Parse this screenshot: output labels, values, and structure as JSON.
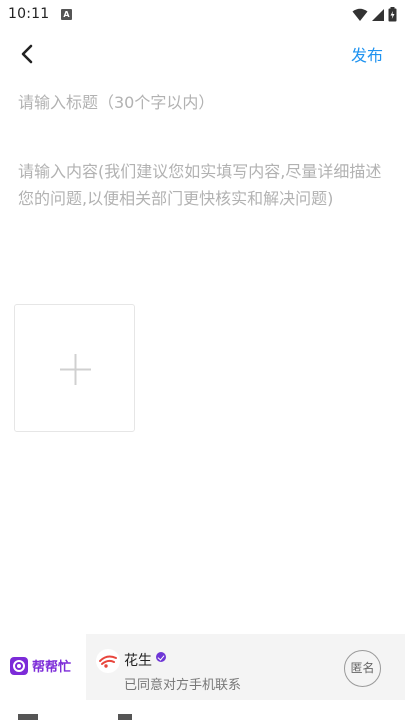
{
  "status_bar": {
    "time": "10:11",
    "app_icon": "A"
  },
  "header": {
    "back_icon": "chevron-left-icon",
    "publish_label": "发布",
    "accent_color": "#1f93f0"
  },
  "form": {
    "title_placeholder": "请输入标题（30个字以内）",
    "content_placeholder": "请输入内容(我们建议您如实填写内容,尽量详细描述您的问题,以便相关部门更快核实和解决问题)",
    "upload_icon": "plus-icon"
  },
  "footer": {
    "brand_label": "帮帮忙",
    "brand_color": "#7c2bd8",
    "user_name": "花生",
    "consent_text": "已同意对方手机联系",
    "anonymous_label": "匿名"
  }
}
